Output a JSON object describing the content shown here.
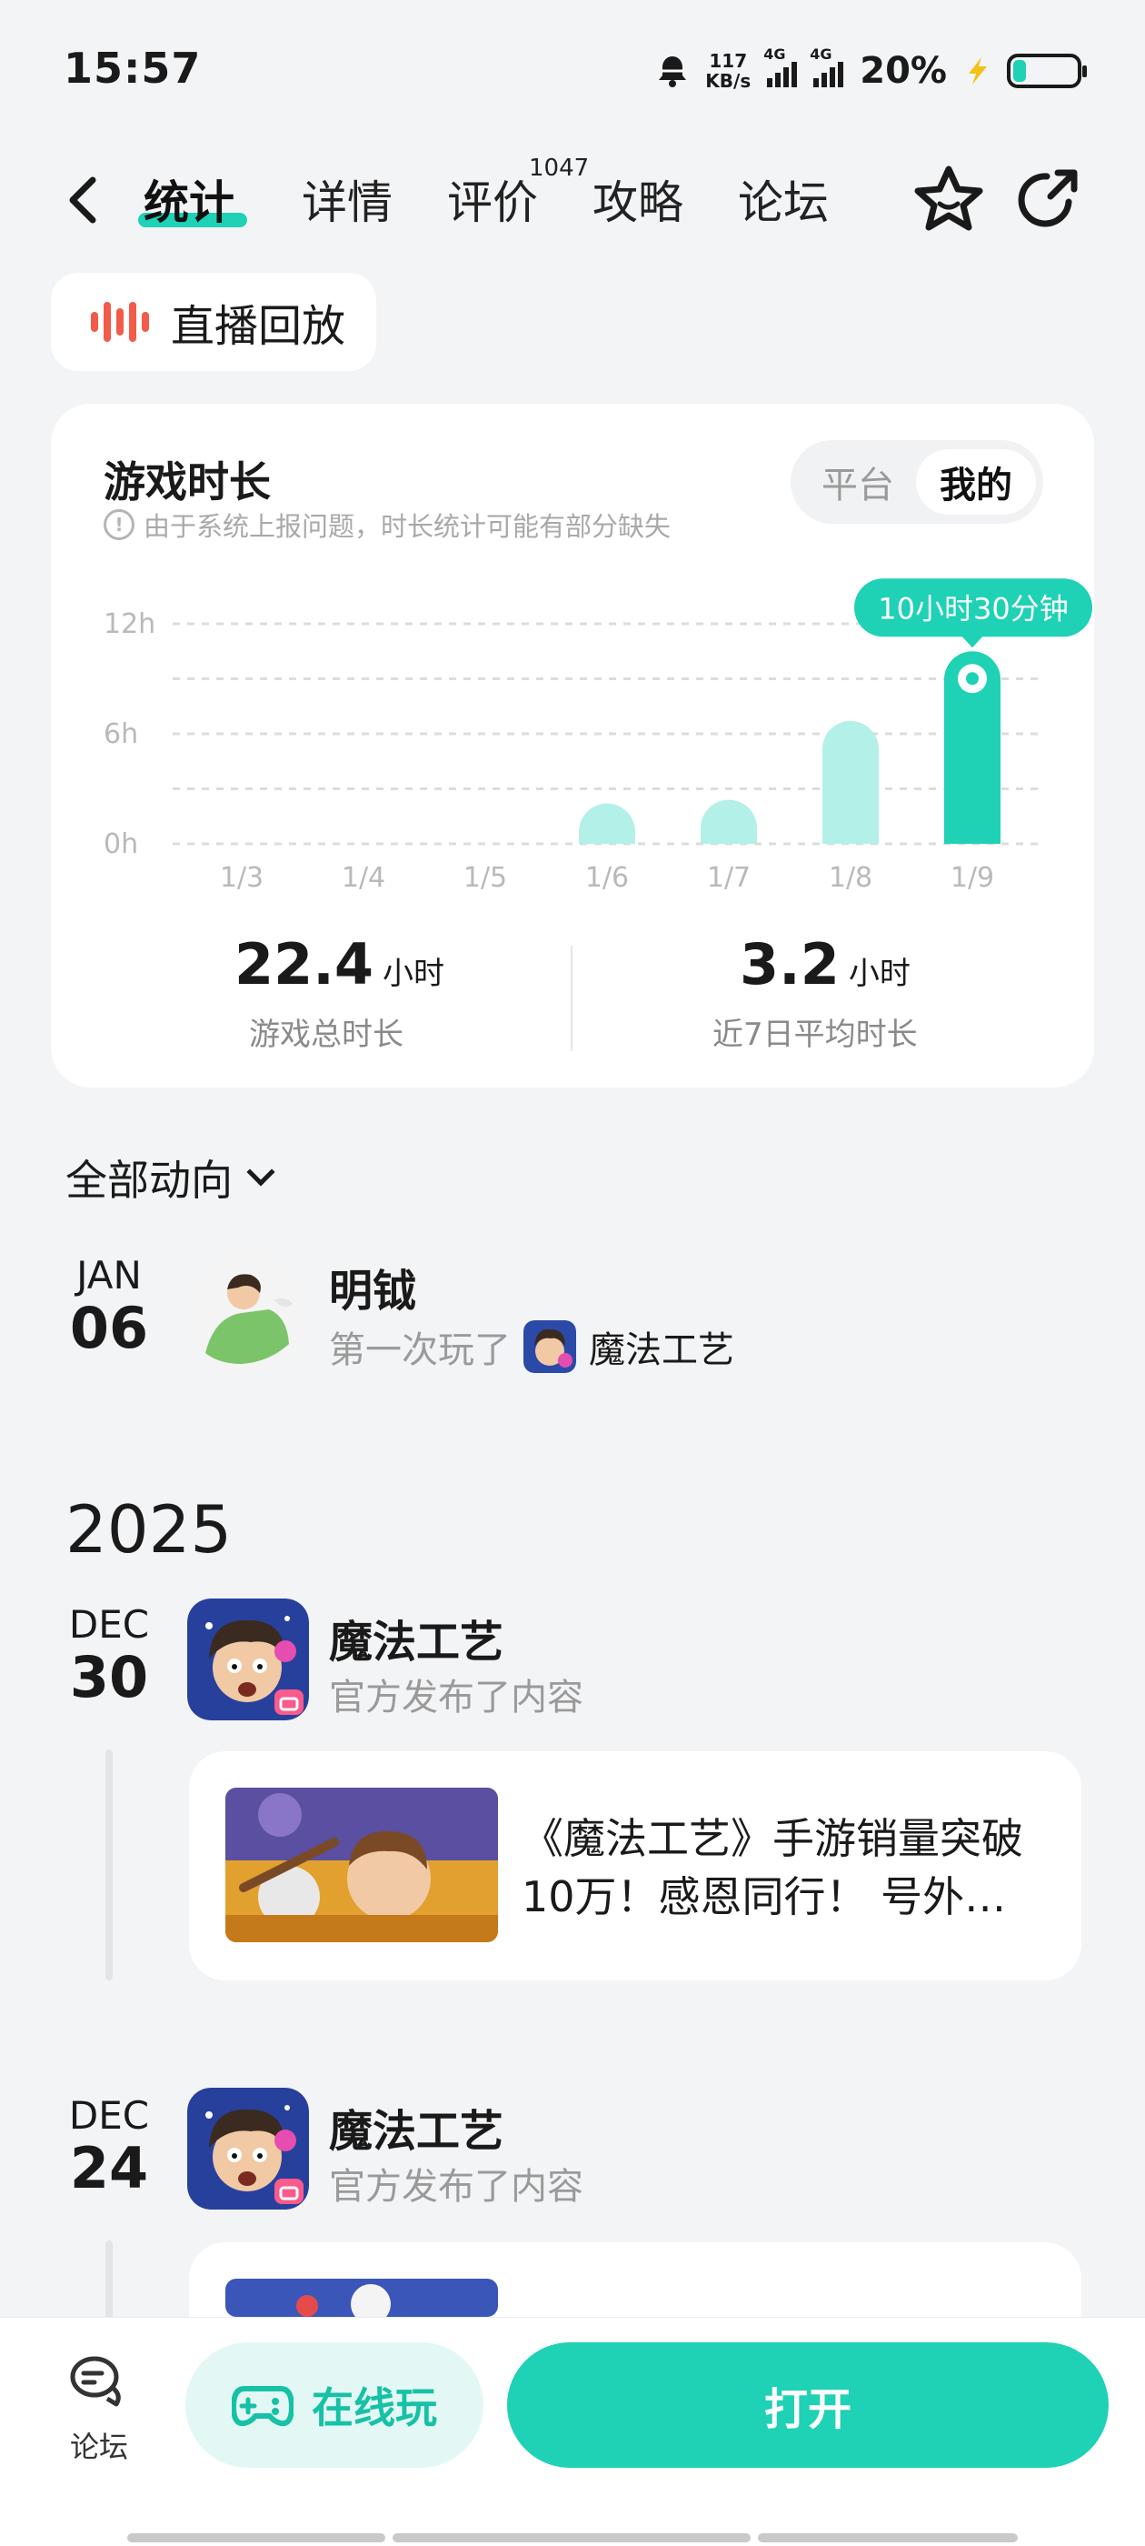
{
  "status": {
    "time": "15:57",
    "speed_value": "117",
    "speed_unit": "KB/s",
    "net1": "4G",
    "net2": "4G",
    "battery": "20%",
    "battery_level": 0.2
  },
  "nav": {
    "tabs": [
      {
        "label": "统计",
        "active": true
      },
      {
        "label": "详情"
      },
      {
        "label": "评价",
        "badge": "1047"
      },
      {
        "label": "攻略"
      },
      {
        "label": "论坛"
      }
    ]
  },
  "replay": {
    "label": "直播回放"
  },
  "playtime": {
    "title": "游戏时长",
    "note": "由于系统上报问题，时长统计可能有部分缺失",
    "toggle": [
      "平台",
      "我的"
    ],
    "tooltip": "10小时30分钟",
    "total": {
      "value": "22.4",
      "unit": "小时",
      "label": "游戏总时长"
    },
    "avg": {
      "value": "3.2",
      "unit": "小时",
      "label": "近7日平均时长"
    }
  },
  "chart_data": {
    "type": "bar",
    "categories": [
      "1/3",
      "1/4",
      "1/5",
      "1/6",
      "1/7",
      "1/8",
      "1/9"
    ],
    "values": [
      0,
      0,
      0,
      2.2,
      2.4,
      6.7,
      10.5
    ],
    "ylim": [
      0,
      12
    ],
    "yticks": [
      "0h",
      "6h",
      "12h"
    ],
    "highlight_index": 6,
    "colors": {
      "bar": "#b3f0e8",
      "highlight": "#1fd1b5"
    }
  },
  "feed": {
    "filter": "全部动向",
    "items": [
      {
        "month": "JAN",
        "day": "06",
        "name": "明钺",
        "text": "第一次玩了",
        "game": "魔法工艺"
      }
    ],
    "year": "2025",
    "official": [
      {
        "month": "DEC",
        "day": "30",
        "name": "魔法工艺",
        "text": "官方发布了内容",
        "post_title": "《魔法工艺》手游销量突破10万！感恩同行！ 号外…"
      },
      {
        "month": "DEC",
        "day": "24",
        "name": "魔法工艺",
        "text": "官方发布了内容"
      }
    ]
  },
  "bottom": {
    "forum": "论坛",
    "cloud": "在线玩",
    "open": "打开"
  },
  "colors": {
    "accent": "#1fd1b5",
    "replay_bars": "#f25a4a"
  }
}
